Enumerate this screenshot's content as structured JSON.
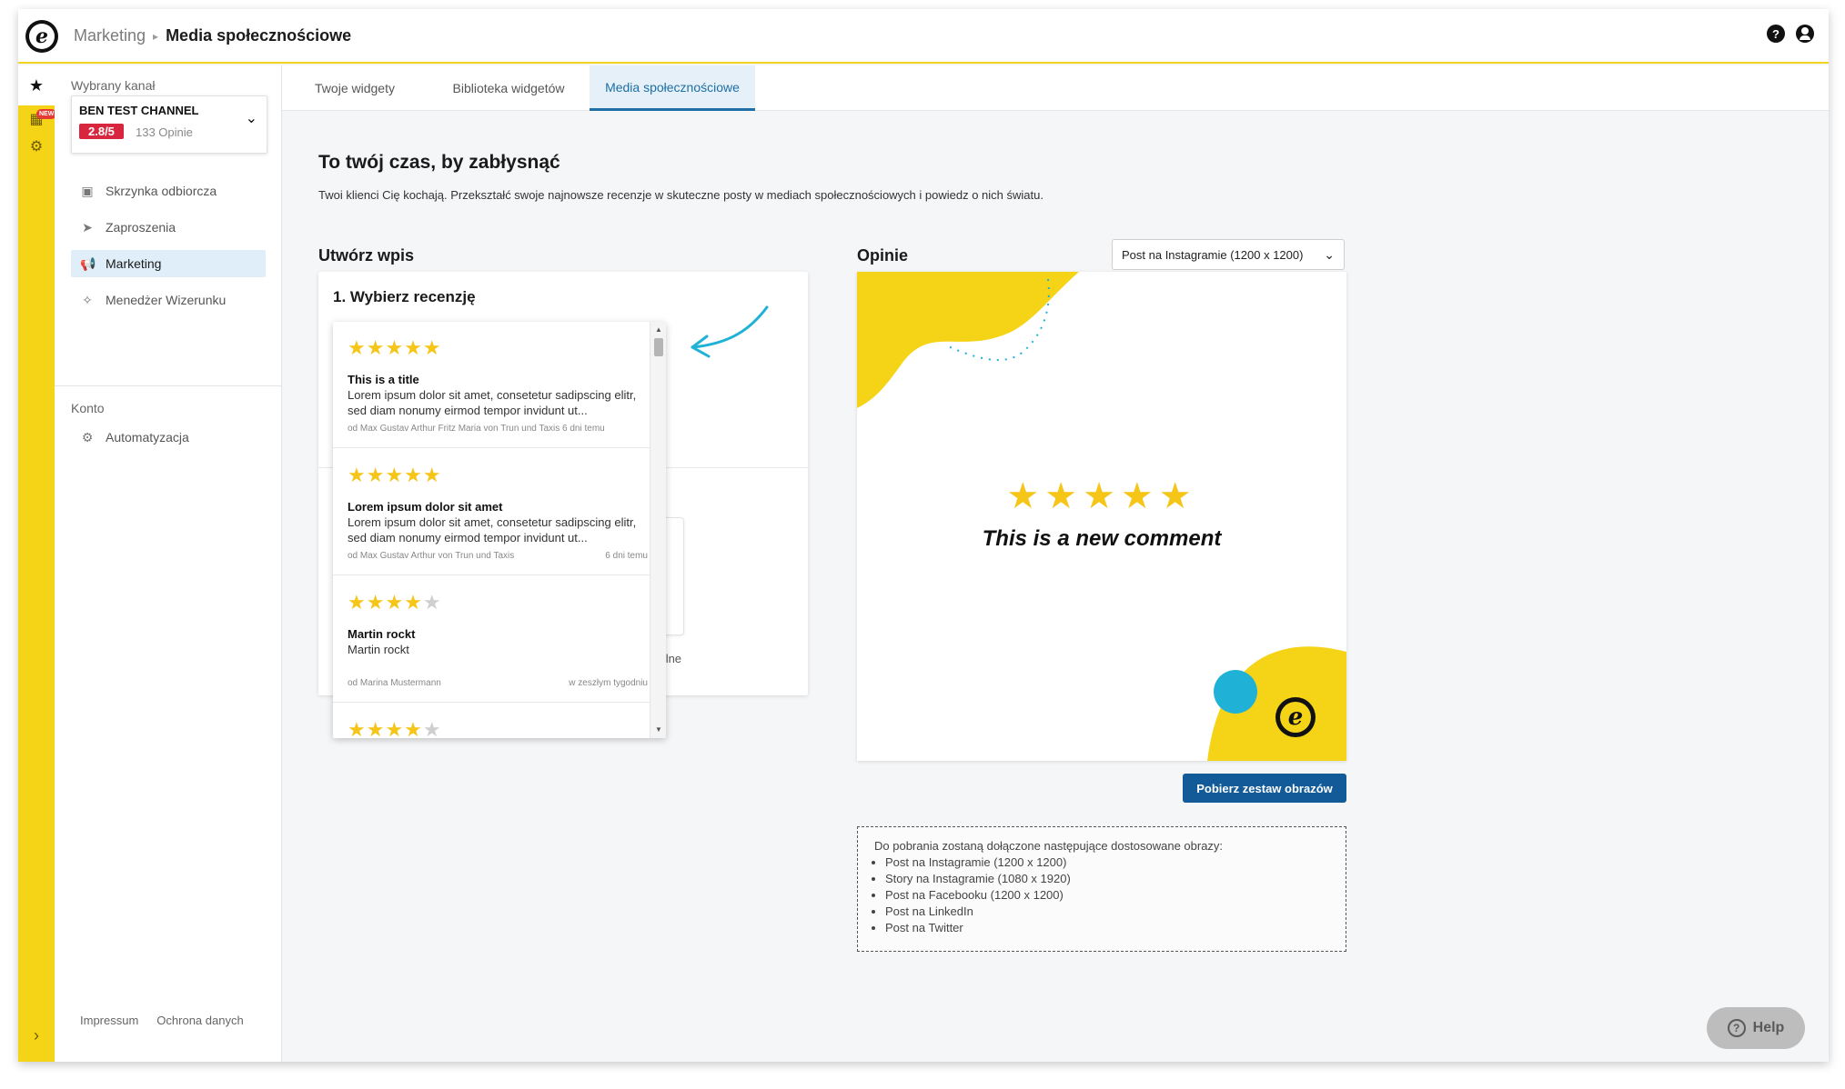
{
  "header": {
    "breadcrumb_parent": "Marketing",
    "breadcrumb_separator": "▸",
    "breadcrumb_current": "Media społecznościowe",
    "help_icon": "question-circle-icon",
    "user_icon": "user-circle-icon"
  },
  "rail": {
    "new_badge": "NEW"
  },
  "sidebar": {
    "channel_label": "Wybrany kanał",
    "channel_name": "BEN TEST CHANNEL",
    "channel_rating": "2.8/5",
    "channel_reviews": "133 Opinie",
    "items": [
      {
        "label": "Skrzynka odbiorcza",
        "icon": "inbox-icon"
      },
      {
        "label": "Zaproszenia",
        "icon": "paper-plane-icon"
      },
      {
        "label": "Marketing",
        "icon": "megaphone-icon"
      },
      {
        "label": "Menedżer Wizerunku",
        "icon": "sparkle-icon"
      }
    ],
    "account_label": "Konto",
    "account_items": [
      {
        "label": "Automatyzacja",
        "icon": "robot-icon"
      }
    ],
    "footer": {
      "impressum": "Impressum",
      "privacy": "Ochrona danych"
    }
  },
  "tabs": [
    {
      "label": "Twoje widgety"
    },
    {
      "label": "Biblioteka widgetów"
    },
    {
      "label": "Media społecznościowe"
    }
  ],
  "main": {
    "title": "To twój czas, by zabłysnąć",
    "subtitle": "Twoi klienci Cię kochają. Przekształć swoje najnowsze recenzje w skuteczne posty w mediach społecznościowych i powiedz o nich światu.",
    "create_heading": "Utwórz wpis",
    "step1_title": "1. Wybierz recenzję",
    "ghost_label": "ogólne",
    "reviews": [
      {
        "stars": 5,
        "title": "This is a title",
        "body": "Lorem ipsum dolor sit amet, consetetur sadipscing elitr, sed diam nonumy eirmod tempor invidunt ut...",
        "meta": "od Max Gustav Arthur Fritz Maria von Trun und Taxis 6 dni temu",
        "date": ""
      },
      {
        "stars": 5,
        "title": "Lorem ipsum dolor sit amet",
        "body": "Lorem ipsum dolor sit amet, consetetur sadipscing elitr, sed diam nonumy eirmod tempor invidunt ut...",
        "meta": "od Max Gustav Arthur von Trun und Taxis",
        "date": "6 dni temu"
      },
      {
        "stars": 4,
        "title": "Martin rockt",
        "body": "Martin rockt",
        "meta": "od Marina Mustermann",
        "date": "w zeszłym tygodniu"
      },
      {
        "stars": 4,
        "title": "",
        "body": "",
        "meta": "",
        "date": ""
      }
    ],
    "opinions_heading": "Opinie",
    "format_selected": "Post na Instagramie (1200 x 1200)",
    "preview_stars": "★★★★★",
    "preview_comment": "This is a new comment",
    "download_button": "Pobierz zestaw obrazów",
    "info_intro": "Do pobrania zostaną dołączone następujące dostosowane obrazy:",
    "info_items": [
      "Post na Instagramie (1200 x 1200)",
      "Story na Instagramie (1080 x 1920)",
      "Post na Facebooku (1200 x 1200)",
      "Post na LinkedIn",
      "Post na Twitter"
    ],
    "help_button": "Help"
  },
  "colors": {
    "brand_yellow": "#f5d417",
    "accent_blue": "#125b98",
    "rating_red": "#d7263d",
    "preview_cyan": "#1fb2d6",
    "star_gold": "#f5c518"
  }
}
